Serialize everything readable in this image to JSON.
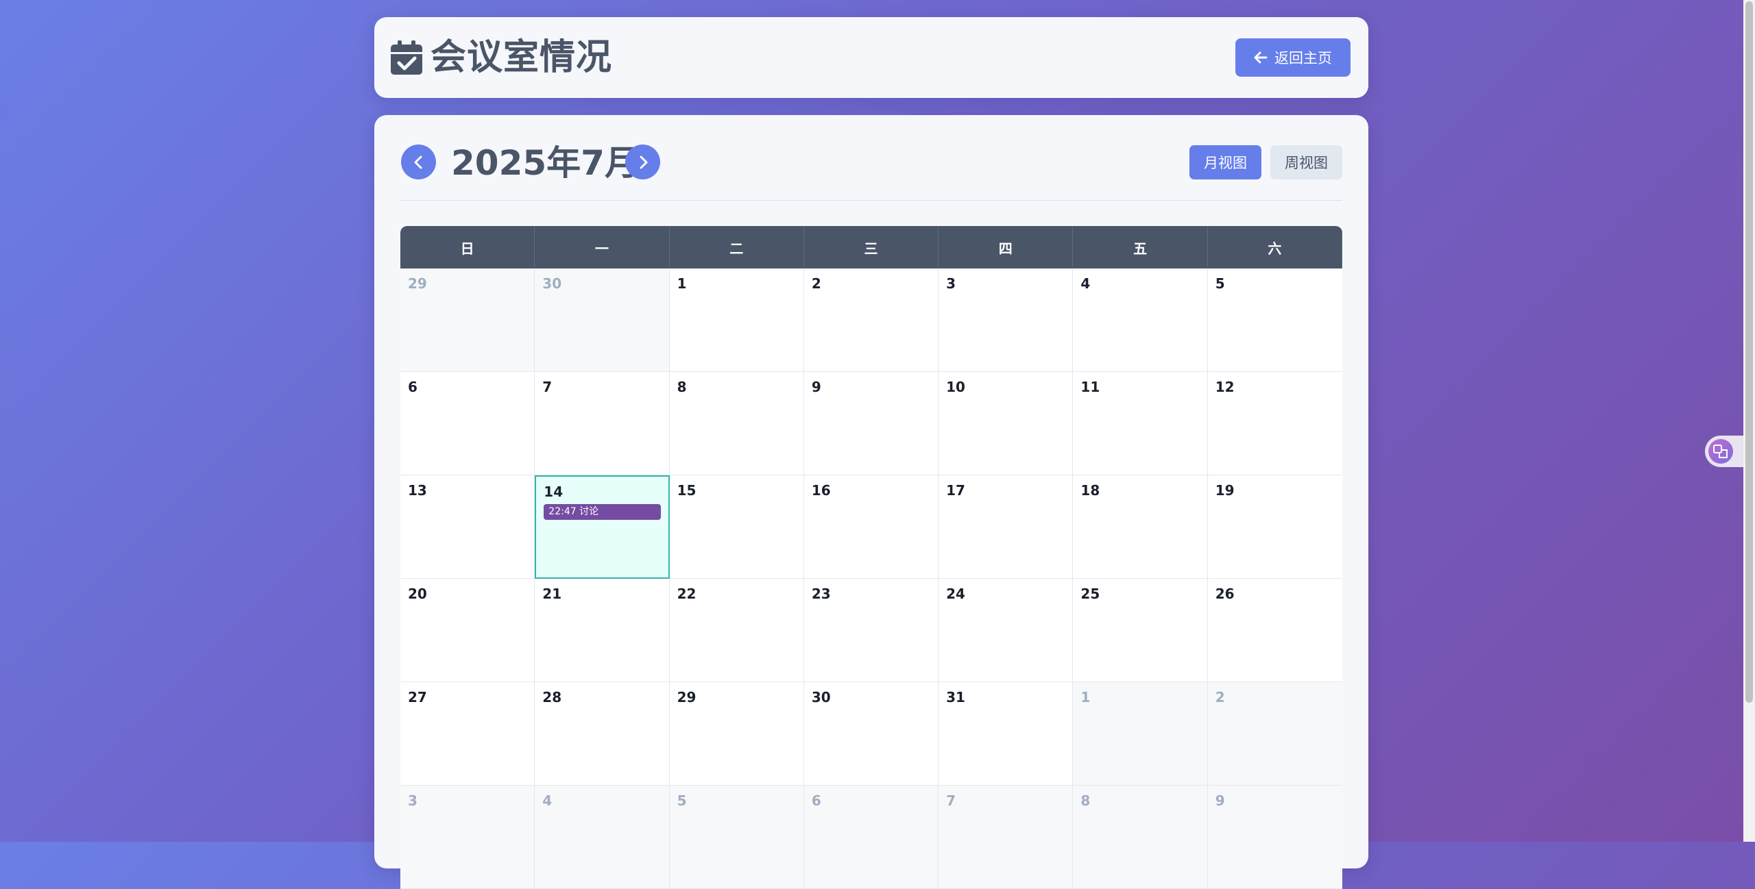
{
  "header": {
    "title": "会议室情况",
    "title_icon": "calendar-check-icon",
    "home_button_label": "返回主页",
    "home_button_icon": "arrow-left-icon"
  },
  "calendar": {
    "month_title": "2025年7月",
    "prev_icon": "chevron-left-icon",
    "next_icon": "chevron-right-icon",
    "month_view_label": "月视图",
    "week_view_label": "周视图",
    "weekdays": [
      "日",
      "一",
      "二",
      "三",
      "四",
      "五",
      "六"
    ],
    "days": [
      {
        "day": 29,
        "other": true
      },
      {
        "day": 30,
        "other": true
      },
      {
        "day": 1
      },
      {
        "day": 2
      },
      {
        "day": 3
      },
      {
        "day": 4
      },
      {
        "day": 5
      },
      {
        "day": 6
      },
      {
        "day": 7
      },
      {
        "day": 8
      },
      {
        "day": 9
      },
      {
        "day": 10
      },
      {
        "day": 11
      },
      {
        "day": 12
      },
      {
        "day": 13
      },
      {
        "day": 14,
        "today": true,
        "events": [
          "22:47 讨论"
        ]
      },
      {
        "day": 15
      },
      {
        "day": 16
      },
      {
        "day": 17
      },
      {
        "day": 18
      },
      {
        "day": 19
      },
      {
        "day": 20
      },
      {
        "day": 21
      },
      {
        "day": 22
      },
      {
        "day": 23
      },
      {
        "day": 24
      },
      {
        "day": 25
      },
      {
        "day": 26
      },
      {
        "day": 27
      },
      {
        "day": 28
      },
      {
        "day": 29
      },
      {
        "day": 30
      },
      {
        "day": 31
      },
      {
        "day": 1,
        "other": true
      },
      {
        "day": 2,
        "other": true
      },
      {
        "day": 3,
        "other": true
      },
      {
        "day": 4,
        "other": true
      },
      {
        "day": 5,
        "other": true
      },
      {
        "day": 6,
        "other": true
      },
      {
        "day": 7,
        "other": true
      },
      {
        "day": 8,
        "other": true
      },
      {
        "day": 9,
        "other": true
      }
    ]
  },
  "widgets": {
    "translate_icon": "translate-icon"
  },
  "colors": {
    "accent": "#667eea",
    "header_row": "#4a5568",
    "event": "#764ba2",
    "today_bg": "#e6fffa",
    "today_border": "#38b2ac"
  }
}
